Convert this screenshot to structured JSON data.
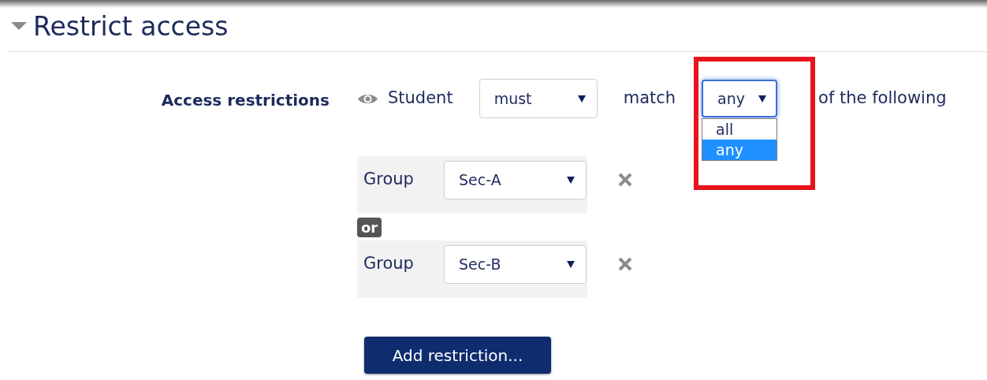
{
  "section": {
    "title": "Restrict access",
    "expanded": true
  },
  "restrictions": {
    "label": "Access restrictions",
    "audience": "Student",
    "mode": {
      "value": "must"
    },
    "match_label": "match",
    "match": {
      "value": "any",
      "open": true,
      "options": [
        {
          "label": "all",
          "selected": false
        },
        {
          "label": "any",
          "selected": true
        }
      ]
    },
    "suffix": "of the following",
    "conditions": [
      {
        "type": "Group",
        "value": "Sec-A"
      },
      {
        "type": "Group",
        "value": "Sec-B"
      }
    ],
    "connector": "or",
    "add_button": "Add restriction..."
  }
}
